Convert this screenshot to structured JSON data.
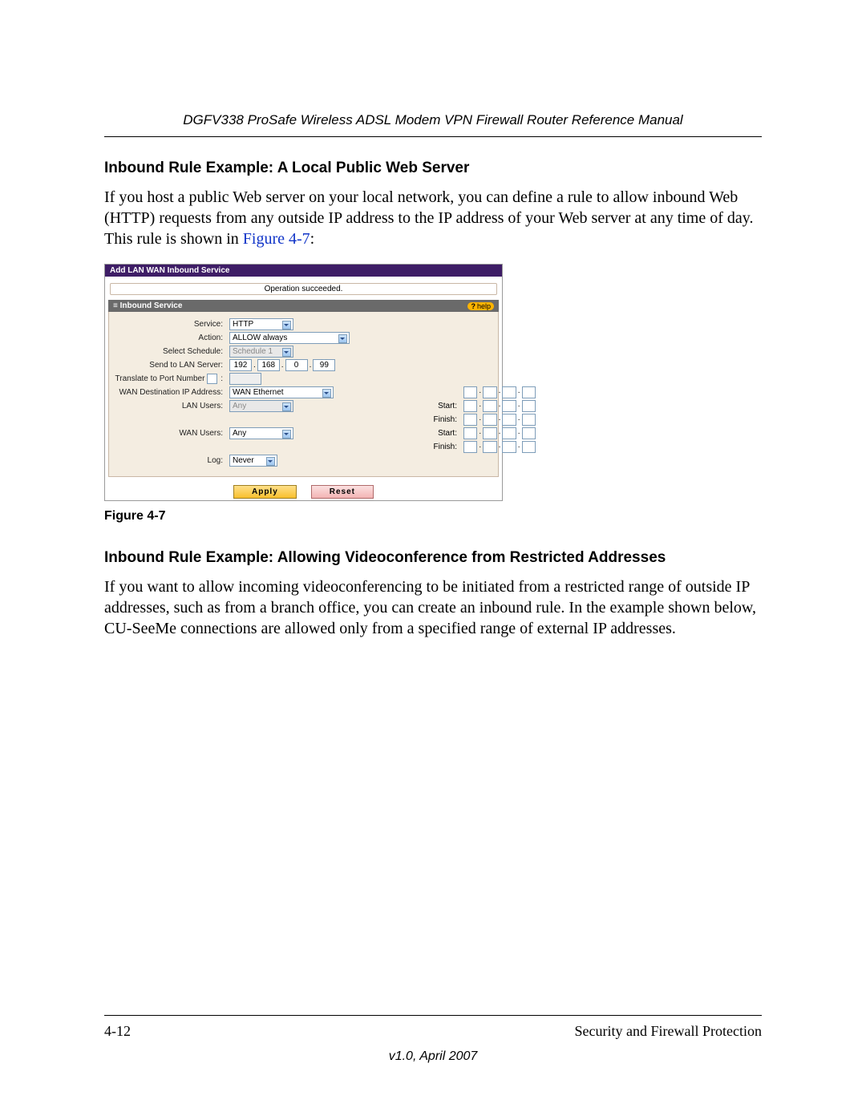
{
  "header": {
    "manual_title": "DGFV338 ProSafe Wireless ADSL Modem VPN Firewall Router Reference Manual"
  },
  "section1": {
    "heading": "Inbound Rule Example: A Local Public Web Server",
    "paragraph_pre": "If you host a public Web server on your local network, you can define a rule to allow inbound Web (HTTP) requests from any outside IP address to the IP address of your Web server at any time of day. This rule is shown in ",
    "figure_ref": "Figure 4-7",
    "paragraph_post": ":"
  },
  "figure": {
    "caption": "Figure 4-7",
    "titlebar": "Add LAN WAN Inbound Service",
    "status": "Operation succeeded.",
    "section_title": "Inbound Service",
    "help_label": "help",
    "labels": {
      "service": "Service:",
      "action": "Action:",
      "schedule": "Select Schedule:",
      "send_to": "Send to LAN Server:",
      "translate": "Translate to Port Number",
      "wan_dest": "WAN Destination IP Address:",
      "lan_users": "LAN Users:",
      "wan_users": "WAN Users:",
      "log": "Log:",
      "start": "Start:",
      "finish": "Finish:"
    },
    "values": {
      "service": "HTTP",
      "action": "ALLOW always",
      "schedule": "Schedule 1",
      "ip": [
        "192",
        "168",
        "0",
        "99"
      ],
      "translate_port": "",
      "wan_dest": "WAN Ethernet",
      "lan_users": "Any",
      "wan_users": "Any",
      "log": "Never"
    },
    "buttons": {
      "apply": "Apply",
      "reset": "Reset"
    }
  },
  "section2": {
    "heading": "Inbound Rule Example: Allowing Videoconference from Restricted Addresses",
    "paragraph": "If you want to allow incoming videoconferencing to be initiated from a restricted range of outside IP addresses, such as from a branch office, you can create an inbound rule. In the example shown below, CU-SeeMe connections are allowed only from a specified range of external IP addresses."
  },
  "footer": {
    "page_num": "4-12",
    "section_name": "Security and Firewall Protection",
    "version": "v1.0, April 2007"
  }
}
